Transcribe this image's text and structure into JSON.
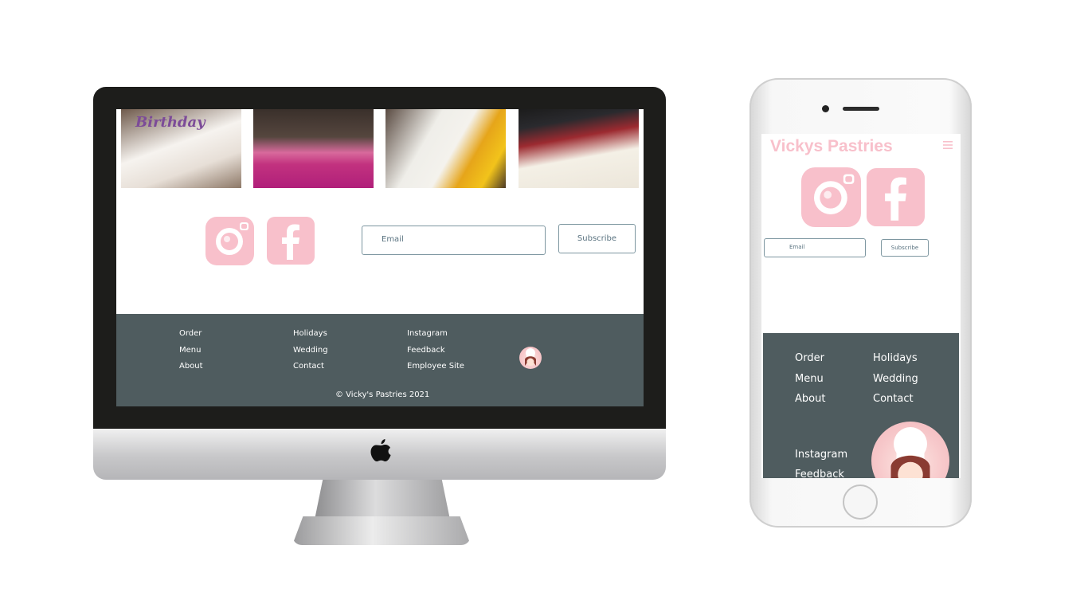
{
  "desktop": {
    "images": [
      "birthday-cake",
      "pink-rosette-cake",
      "sunflower-cake",
      "pokeball-cake"
    ],
    "cake1_text": "Birthday",
    "social": [
      "instagram-icon",
      "facebook-icon"
    ],
    "subscribe": {
      "email_placeholder": "Email",
      "button_label": "Subscribe"
    },
    "footer": {
      "col1": [
        "Order",
        "Menu",
        "About"
      ],
      "col2": [
        "Holidays",
        "Wedding",
        "Contact"
      ],
      "col3": [
        "Instagram",
        "Feedback",
        "Employee Site"
      ],
      "copyright": "© Vicky's Pastries 2021"
    }
  },
  "mobile": {
    "title": "Vickys Pastries",
    "subscribe": {
      "email_placeholder": "Email",
      "button_label": "Subscribe"
    },
    "footer": {
      "col1": [
        "Order",
        "Menu",
        "About"
      ],
      "col2": [
        "Holidays",
        "Wedding",
        "Contact"
      ],
      "col3": [
        "Instagram",
        "Feedback"
      ]
    }
  },
  "colors": {
    "pink": "#f8c0cb",
    "footer": "#4f5c5f",
    "border": "#7d96a0"
  }
}
